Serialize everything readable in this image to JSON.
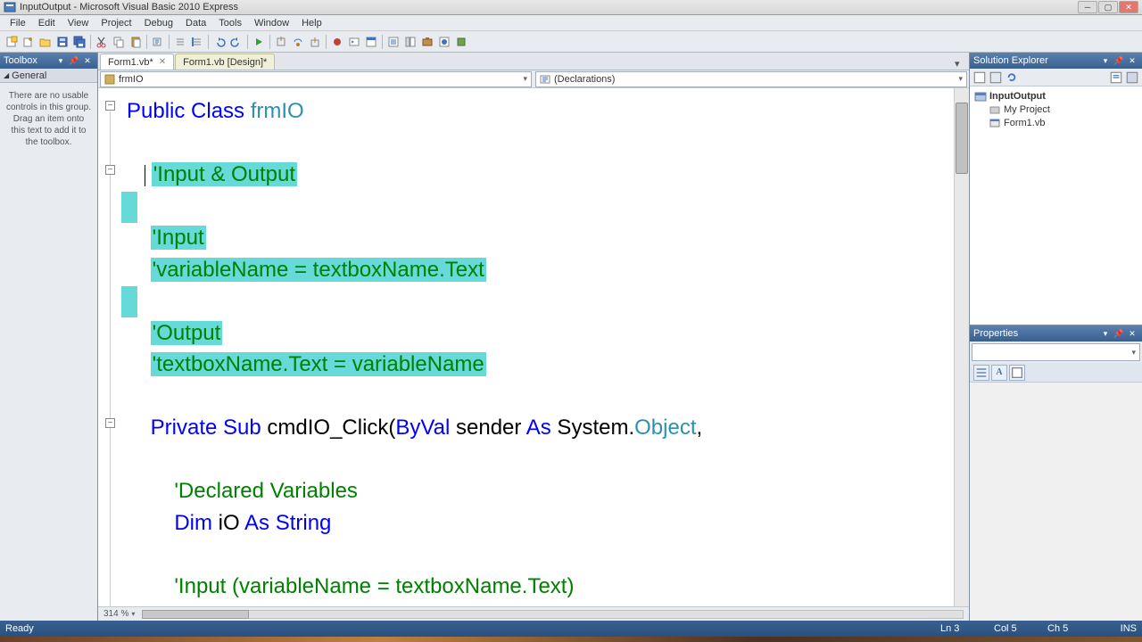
{
  "titlebar": {
    "title": "InputOutput - Microsoft Visual Basic 2010 Express"
  },
  "menubar": {
    "items": [
      "File",
      "Edit",
      "View",
      "Project",
      "Debug",
      "Data",
      "Tools",
      "Window",
      "Help"
    ]
  },
  "toolbox": {
    "header": "Toolbox",
    "group": "General",
    "message": "There are no usable controls in this group. Drag an item onto this text to add it to the toolbox."
  },
  "tabs": [
    {
      "label": "Form1.vb*",
      "active": true
    },
    {
      "label": "Form1.vb [Design]*",
      "active": false
    }
  ],
  "nav": {
    "left_icon": "class-icon",
    "left": "frmIO",
    "right_icon": "declarations-icon",
    "right": "(Declarations)"
  },
  "code": {
    "lines": [
      {
        "indent": 0,
        "segs": [
          {
            "t": "Public Class ",
            "c": "kw"
          },
          {
            "t": "frmIO",
            "c": "typ"
          }
        ]
      },
      {
        "indent": 0,
        "segs": []
      },
      {
        "indent": 1,
        "segs": [
          {
            "t": "'Input & Output",
            "c": "comment",
            "hl": true
          }
        ],
        "cursor_before": true
      },
      {
        "indent": 1,
        "segs": [],
        "hl_block": true
      },
      {
        "indent": 1,
        "segs": [
          {
            "t": "'Input",
            "c": "comment",
            "hl": true
          }
        ]
      },
      {
        "indent": 1,
        "segs": [
          {
            "t": "'variableName = textboxName.Text",
            "c": "comment",
            "hl": true
          }
        ]
      },
      {
        "indent": 1,
        "segs": [],
        "hl_block": true
      },
      {
        "indent": 1,
        "segs": [
          {
            "t": "'Output",
            "c": "comment",
            "hl": true
          }
        ]
      },
      {
        "indent": 1,
        "segs": [
          {
            "t": "'textboxName.Text = variableName",
            "c": "comment",
            "hl": true
          }
        ]
      },
      {
        "indent": 0,
        "segs": []
      },
      {
        "indent": 1,
        "segs": [
          {
            "t": "Private Sub ",
            "c": "kw"
          },
          {
            "t": "cmdIO_Click(",
            "c": ""
          },
          {
            "t": "ByVal",
            "c": "kw"
          },
          {
            "t": " sender ",
            "c": ""
          },
          {
            "t": "As",
            "c": "kw"
          },
          {
            "t": " System.",
            "c": ""
          },
          {
            "t": "Object",
            "c": "typ"
          },
          {
            "t": ",",
            "c": ""
          }
        ]
      },
      {
        "indent": 0,
        "segs": []
      },
      {
        "indent": 2,
        "segs": [
          {
            "t": "'Declared Variables",
            "c": "comment"
          }
        ]
      },
      {
        "indent": 2,
        "segs": [
          {
            "t": "Dim",
            "c": "kw"
          },
          {
            "t": " iO ",
            "c": ""
          },
          {
            "t": "As String",
            "c": "kw"
          }
        ]
      },
      {
        "indent": 0,
        "segs": []
      },
      {
        "indent": 2,
        "segs": [
          {
            "t": "'Input (variableName = textboxName.Text)",
            "c": "comment"
          }
        ]
      }
    ]
  },
  "zoom": "314 %",
  "solution_explorer": {
    "header": "Solution Explorer",
    "root": "InputOutput",
    "children": [
      "My Project",
      "Form1.vb"
    ]
  },
  "properties": {
    "header": "Properties"
  },
  "statusbar": {
    "status": "Ready",
    "ln": "Ln 3",
    "col": "Col 5",
    "ch": "Ch 5",
    "ins": "INS"
  }
}
